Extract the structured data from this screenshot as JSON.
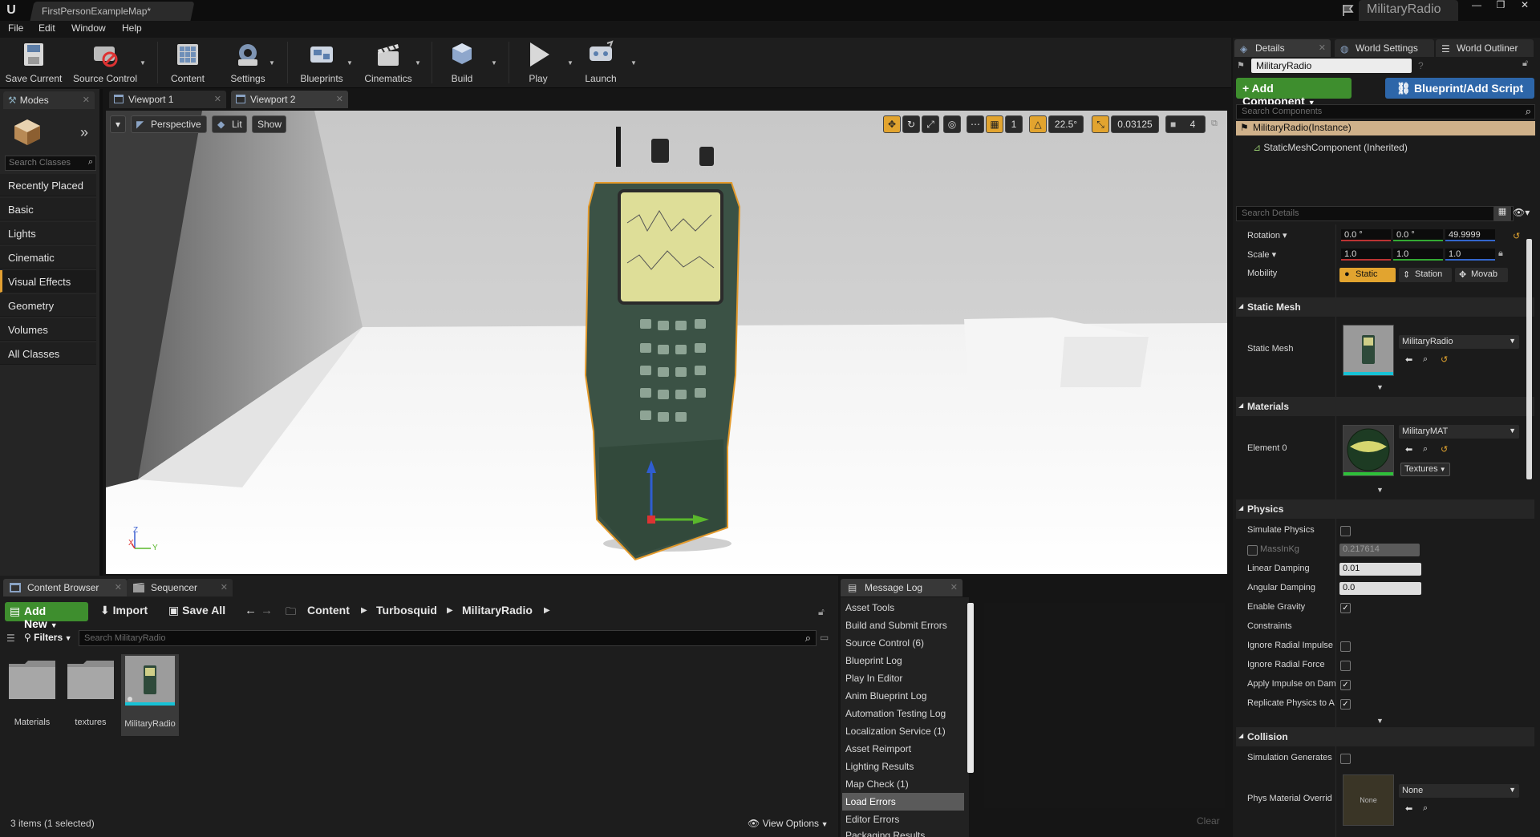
{
  "titlebar": {
    "doc_tab": "FirstPersonExampleMap*",
    "project": "MilitaryRadio"
  },
  "menu": [
    "File",
    "Edit",
    "Window",
    "Help"
  ],
  "toolbar": [
    {
      "label": "Save Current",
      "icon": "save-icon"
    },
    {
      "label": "Source Control",
      "icon": "source-control-icon"
    },
    {
      "label": "Content",
      "icon": "content-icon"
    },
    {
      "label": "Settings",
      "icon": "settings-icon"
    },
    {
      "label": "Blueprints",
      "icon": "blueprints-icon"
    },
    {
      "label": "Cinematics",
      "icon": "cinematics-icon"
    },
    {
      "label": "Build",
      "icon": "build-icon"
    },
    {
      "label": "Play",
      "icon": "play-icon"
    },
    {
      "label": "Launch",
      "icon": "launch-icon"
    }
  ],
  "modes": {
    "tab": "Modes",
    "search_placeholder": "Search Classes",
    "categories": [
      "Recently Placed",
      "Basic",
      "Lights",
      "Cinematic",
      "Visual Effects",
      "Geometry",
      "Volumes",
      "All Classes"
    ],
    "selected": "Visual Effects"
  },
  "viewport_tabs": [
    "Viewport 1",
    "Viewport 2"
  ],
  "viewport": {
    "perspective": "Perspective",
    "lit": "Lit",
    "show": "Show",
    "snap_angle": "22.5°",
    "scale_snap": "0.03125",
    "camera_speed": "4",
    "grid_num": "1",
    "axis_z": "Z",
    "axis_x": "X",
    "axis_y": "Y"
  },
  "content_browser": {
    "tabs": [
      "Content Browser",
      "Sequencer"
    ],
    "add_new": "Add New",
    "import": "Import",
    "save_all": "Save All",
    "path": [
      "Content",
      "Turbosquid",
      "MilitaryRadio"
    ],
    "filters": "Filters",
    "search_placeholder": "Search MilitaryRadio",
    "assets": [
      "Materials",
      "textures",
      "MilitaryRadio"
    ],
    "status": "3 items (1 selected)",
    "view_options": "View Options"
  },
  "message_log": {
    "tab": "Message Log",
    "items": [
      "Asset Tools",
      "Build and Submit Errors",
      "Source Control (6)",
      "Blueprint Log",
      "Play In Editor",
      "Anim Blueprint Log",
      "Automation Testing Log",
      "Localization Service (1)",
      "Asset Reimport",
      "Lighting Results",
      "Map Check (1)",
      "Load Errors",
      "Editor Errors",
      "Packaging Results"
    ],
    "selected": "Load Errors",
    "clear": "Clear"
  },
  "details": {
    "tabs": [
      "Details",
      "World Settings",
      "World Outliner"
    ],
    "name": "MilitaryRadio",
    "add_component": "+ Add Component",
    "blueprint_add": "Blueprint/Add Script",
    "search_components": "Search Components",
    "root": "MilitaryRadio(Instance)",
    "child": "StaticMeshComponent (Inherited)",
    "search_details": "Search Details",
    "rotation_label": "Rotation",
    "rotation": [
      "0.0 °",
      "0.0 °",
      "49.9999"
    ],
    "scale_label": "Scale",
    "scale": [
      "1.0",
      "1.0",
      "1.0"
    ],
    "mobility_label": "Mobility",
    "mobility": [
      "Static",
      "Station",
      "Movab"
    ],
    "static_mesh_section": "Static Mesh",
    "static_mesh_label": "Static Mesh",
    "static_mesh_value": "MilitaryRadio",
    "materials_section": "Materials",
    "element0_label": "Element 0",
    "material_value": "MilitaryMAT",
    "textures": "Textures",
    "physics_section": "Physics",
    "simulate_physics": "Simulate Physics",
    "mass_label": "MassInKg",
    "mass_value": "0.217614",
    "linear_damping": "Linear Damping",
    "linear_damping_value": "0.01",
    "angular_damping": "Angular Damping",
    "angular_damping_value": "0.0",
    "enable_gravity": "Enable Gravity",
    "constraints": "Constraints",
    "ignore_radial_impulse": "Ignore Radial Impulse",
    "ignore_radial_force": "Ignore Radial Force",
    "apply_impulse": "Apply Impulse on Dam",
    "replicate_physics": "Replicate Physics to A",
    "collision_section": "Collision",
    "sim_generates": "Simulation Generates",
    "phys_material": "Phys Material Overrid",
    "phys_material_value": "None",
    "phys_thumb": "None"
  }
}
